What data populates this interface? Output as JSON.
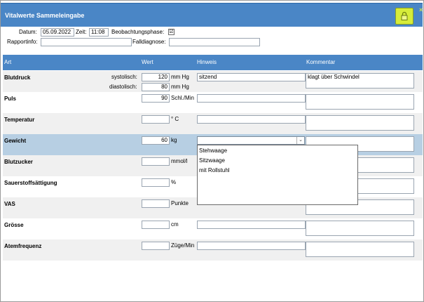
{
  "window": {
    "title": "Vitalwerte Sammeleingabe"
  },
  "header": {
    "datum_label": "Datum:",
    "datum_value": "05.09.2022",
    "zeit_label": "Zeit:",
    "zeit_value": "11:08",
    "beobachtung_label": "Beobachtungsphase:",
    "beobachtung_check": "☑",
    "rapportinfo_label": "Rapportinfo:",
    "rapportinfo_value": "",
    "falldiagnose_label": "Falldiagnose:",
    "falldiagnose_value": ""
  },
  "columns": {
    "art": "Art",
    "wert": "Wert",
    "hinweis": "Hinweis",
    "kommentar": "Kommentar"
  },
  "rows": {
    "blutdruck": {
      "name": "Blutdruck",
      "sys_label": "systolisch:",
      "sys_value": "120",
      "sys_unit": "mm Hg",
      "dia_label": "diastolisch:",
      "dia_value": "80",
      "dia_unit": "mm Hg",
      "hinweis": "sitzend",
      "kommentar": "klagt über Schwindel"
    },
    "puls": {
      "name": "Puls",
      "value": "90",
      "unit": "Schl./Min",
      "hinweis": "",
      "kommentar": ""
    },
    "temperatur": {
      "name": "Temperatur",
      "value": "",
      "unit": "° C",
      "hinweis": "",
      "kommentar": ""
    },
    "gewicht": {
      "name": "Gewicht",
      "value": "60",
      "unit": "kg",
      "hinweis": "",
      "kommentar": ""
    },
    "blutzucker": {
      "name": "Blutzucker",
      "value": "",
      "unit": "mmol/l"
    },
    "sauerstoff": {
      "name": "Sauerstoffsättigung",
      "value": "",
      "unit": "%"
    },
    "vas": {
      "name": "VAS",
      "value": "",
      "unit": "Punkte"
    },
    "groesse": {
      "name": "Grösse",
      "value": "",
      "unit": "cm",
      "hinweis": "",
      "kommentar": ""
    },
    "atemfrequenz": {
      "name": "Atemfrequenz",
      "value": "",
      "unit": "Züge/Min",
      "hinweis": "",
      "kommentar": ""
    }
  },
  "dropdown": {
    "items": [
      "Stehwaage",
      "Sitzwaage",
      "mit Rollstuhl"
    ]
  },
  "colors": {
    "header_blue": "#4a86c6",
    "selected_row": "#b7cfe3",
    "alt_row": "#f0f0f0",
    "lock_yellow": "#d6ec3a"
  }
}
